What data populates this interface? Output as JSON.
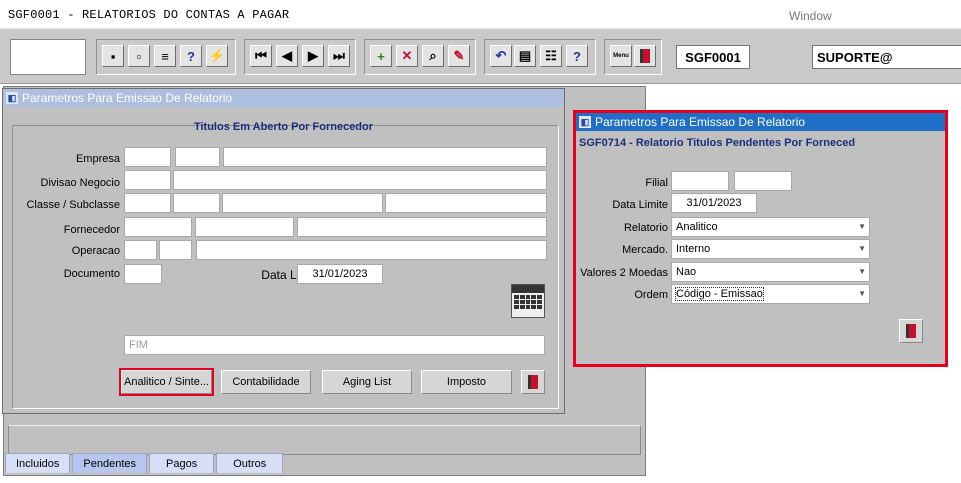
{
  "app": {
    "title": "SGF0001 - RELATORIOS DO CONTAS A PAGAR",
    "window_menu": "Window"
  },
  "toolbar": {
    "form_code": "SGF0001",
    "user": "SUPORTE@",
    "icons": [
      "save-icon",
      "print-preview-icon",
      "print-icon",
      "query-icon",
      "execute-query-icon",
      "first-record-icon",
      "previous-record-icon",
      "next-record-icon",
      "last-record-icon",
      "insert-record-icon",
      "delete-record-icon",
      "search-icon",
      "clear-icon",
      "undo-icon",
      "clipboard-icon",
      "properties-icon",
      "help-icon",
      "menu-icon",
      "exit-icon"
    ],
    "menu_icon_label": "Menu"
  },
  "left_window": {
    "title": "Parametros Para Emissao De Relatorio",
    "group_title": "Titulos Em Aberto Por Fornecedor",
    "labels": {
      "empresa": "Empresa",
      "divisao": "Divisao Negocio",
      "classe": "Classe / Subclasse",
      "fornecedor": "Fornecedor",
      "operacao": "Operacao",
      "documento": "Documento",
      "data_limite": "Data Limite"
    },
    "data_limite_value": "31/01/2023",
    "fim_placeholder": "FIM",
    "buttons": {
      "analitico": "Analitico / Sinte...",
      "contabilidade": "Contabilidade",
      "aging": "Aging List",
      "imposto": "Imposto"
    }
  },
  "right_window": {
    "title": "Parametros Para Emissao De Relatorio",
    "subtitle": "SGF0714 - Relatorio Titulos Pendentes Por Forneced",
    "labels": {
      "filial": "Filial",
      "data_limite": "Data Limite",
      "relatorio": "Relatorio",
      "mercado": "Mercado.",
      "valores": "Valores 2 Moedas",
      "ordem": "Ordem"
    },
    "values": {
      "data_limite": "31/01/2023",
      "relatorio": "Analitico",
      "mercado": "Interno",
      "valores": "Nao",
      "ordem": "Código - Emissao"
    }
  },
  "tabs": [
    "Incluidos",
    "Pendentes",
    "Pagos",
    "Outros"
  ],
  "active_tab": "Pendentes",
  "colors": {
    "highlight": "#e8001c",
    "active_title": "#1f6fc6",
    "inactive_title": "#aebede",
    "group_title": "#1b2e7a"
  }
}
